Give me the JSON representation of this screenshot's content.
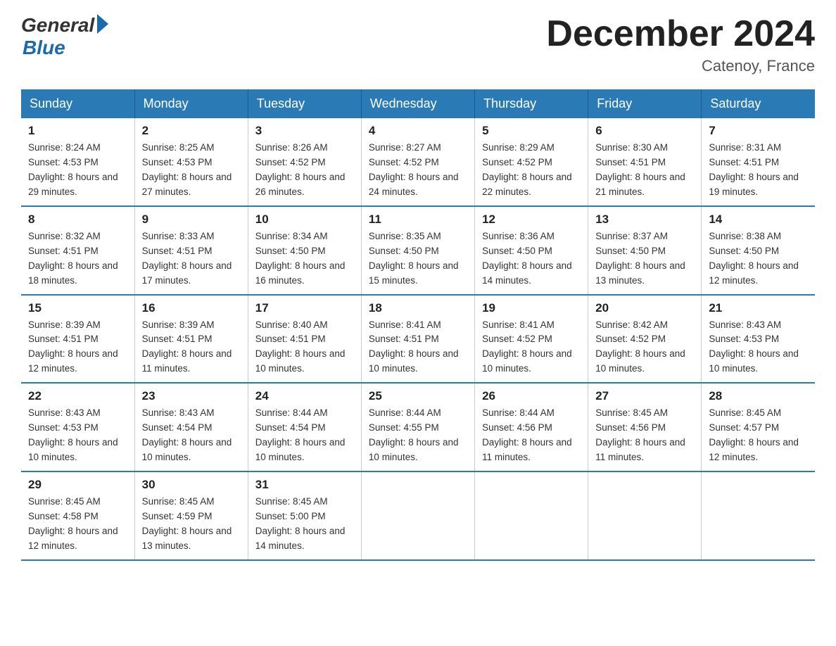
{
  "header": {
    "logo_general": "General",
    "logo_blue": "Blue",
    "month_title": "December 2024",
    "location": "Catenoy, France"
  },
  "days_of_week": [
    "Sunday",
    "Monday",
    "Tuesday",
    "Wednesday",
    "Thursday",
    "Friday",
    "Saturday"
  ],
  "weeks": [
    [
      {
        "day": "1",
        "sunrise": "Sunrise: 8:24 AM",
        "sunset": "Sunset: 4:53 PM",
        "daylight": "Daylight: 8 hours and 29 minutes."
      },
      {
        "day": "2",
        "sunrise": "Sunrise: 8:25 AM",
        "sunset": "Sunset: 4:53 PM",
        "daylight": "Daylight: 8 hours and 27 minutes."
      },
      {
        "day": "3",
        "sunrise": "Sunrise: 8:26 AM",
        "sunset": "Sunset: 4:52 PM",
        "daylight": "Daylight: 8 hours and 26 minutes."
      },
      {
        "day": "4",
        "sunrise": "Sunrise: 8:27 AM",
        "sunset": "Sunset: 4:52 PM",
        "daylight": "Daylight: 8 hours and 24 minutes."
      },
      {
        "day": "5",
        "sunrise": "Sunrise: 8:29 AM",
        "sunset": "Sunset: 4:52 PM",
        "daylight": "Daylight: 8 hours and 22 minutes."
      },
      {
        "day": "6",
        "sunrise": "Sunrise: 8:30 AM",
        "sunset": "Sunset: 4:51 PM",
        "daylight": "Daylight: 8 hours and 21 minutes."
      },
      {
        "day": "7",
        "sunrise": "Sunrise: 8:31 AM",
        "sunset": "Sunset: 4:51 PM",
        "daylight": "Daylight: 8 hours and 19 minutes."
      }
    ],
    [
      {
        "day": "8",
        "sunrise": "Sunrise: 8:32 AM",
        "sunset": "Sunset: 4:51 PM",
        "daylight": "Daylight: 8 hours and 18 minutes."
      },
      {
        "day": "9",
        "sunrise": "Sunrise: 8:33 AM",
        "sunset": "Sunset: 4:51 PM",
        "daylight": "Daylight: 8 hours and 17 minutes."
      },
      {
        "day": "10",
        "sunrise": "Sunrise: 8:34 AM",
        "sunset": "Sunset: 4:50 PM",
        "daylight": "Daylight: 8 hours and 16 minutes."
      },
      {
        "day": "11",
        "sunrise": "Sunrise: 8:35 AM",
        "sunset": "Sunset: 4:50 PM",
        "daylight": "Daylight: 8 hours and 15 minutes."
      },
      {
        "day": "12",
        "sunrise": "Sunrise: 8:36 AM",
        "sunset": "Sunset: 4:50 PM",
        "daylight": "Daylight: 8 hours and 14 minutes."
      },
      {
        "day": "13",
        "sunrise": "Sunrise: 8:37 AM",
        "sunset": "Sunset: 4:50 PM",
        "daylight": "Daylight: 8 hours and 13 minutes."
      },
      {
        "day": "14",
        "sunrise": "Sunrise: 8:38 AM",
        "sunset": "Sunset: 4:50 PM",
        "daylight": "Daylight: 8 hours and 12 minutes."
      }
    ],
    [
      {
        "day": "15",
        "sunrise": "Sunrise: 8:39 AM",
        "sunset": "Sunset: 4:51 PM",
        "daylight": "Daylight: 8 hours and 12 minutes."
      },
      {
        "day": "16",
        "sunrise": "Sunrise: 8:39 AM",
        "sunset": "Sunset: 4:51 PM",
        "daylight": "Daylight: 8 hours and 11 minutes."
      },
      {
        "day": "17",
        "sunrise": "Sunrise: 8:40 AM",
        "sunset": "Sunset: 4:51 PM",
        "daylight": "Daylight: 8 hours and 10 minutes."
      },
      {
        "day": "18",
        "sunrise": "Sunrise: 8:41 AM",
        "sunset": "Sunset: 4:51 PM",
        "daylight": "Daylight: 8 hours and 10 minutes."
      },
      {
        "day": "19",
        "sunrise": "Sunrise: 8:41 AM",
        "sunset": "Sunset: 4:52 PM",
        "daylight": "Daylight: 8 hours and 10 minutes."
      },
      {
        "day": "20",
        "sunrise": "Sunrise: 8:42 AM",
        "sunset": "Sunset: 4:52 PM",
        "daylight": "Daylight: 8 hours and 10 minutes."
      },
      {
        "day": "21",
        "sunrise": "Sunrise: 8:43 AM",
        "sunset": "Sunset: 4:53 PM",
        "daylight": "Daylight: 8 hours and 10 minutes."
      }
    ],
    [
      {
        "day": "22",
        "sunrise": "Sunrise: 8:43 AM",
        "sunset": "Sunset: 4:53 PM",
        "daylight": "Daylight: 8 hours and 10 minutes."
      },
      {
        "day": "23",
        "sunrise": "Sunrise: 8:43 AM",
        "sunset": "Sunset: 4:54 PM",
        "daylight": "Daylight: 8 hours and 10 minutes."
      },
      {
        "day": "24",
        "sunrise": "Sunrise: 8:44 AM",
        "sunset": "Sunset: 4:54 PM",
        "daylight": "Daylight: 8 hours and 10 minutes."
      },
      {
        "day": "25",
        "sunrise": "Sunrise: 8:44 AM",
        "sunset": "Sunset: 4:55 PM",
        "daylight": "Daylight: 8 hours and 10 minutes."
      },
      {
        "day": "26",
        "sunrise": "Sunrise: 8:44 AM",
        "sunset": "Sunset: 4:56 PM",
        "daylight": "Daylight: 8 hours and 11 minutes."
      },
      {
        "day": "27",
        "sunrise": "Sunrise: 8:45 AM",
        "sunset": "Sunset: 4:56 PM",
        "daylight": "Daylight: 8 hours and 11 minutes."
      },
      {
        "day": "28",
        "sunrise": "Sunrise: 8:45 AM",
        "sunset": "Sunset: 4:57 PM",
        "daylight": "Daylight: 8 hours and 12 minutes."
      }
    ],
    [
      {
        "day": "29",
        "sunrise": "Sunrise: 8:45 AM",
        "sunset": "Sunset: 4:58 PM",
        "daylight": "Daylight: 8 hours and 12 minutes."
      },
      {
        "day": "30",
        "sunrise": "Sunrise: 8:45 AM",
        "sunset": "Sunset: 4:59 PM",
        "daylight": "Daylight: 8 hours and 13 minutes."
      },
      {
        "day": "31",
        "sunrise": "Sunrise: 8:45 AM",
        "sunset": "Sunset: 5:00 PM",
        "daylight": "Daylight: 8 hours and 14 minutes."
      },
      null,
      null,
      null,
      null
    ]
  ]
}
